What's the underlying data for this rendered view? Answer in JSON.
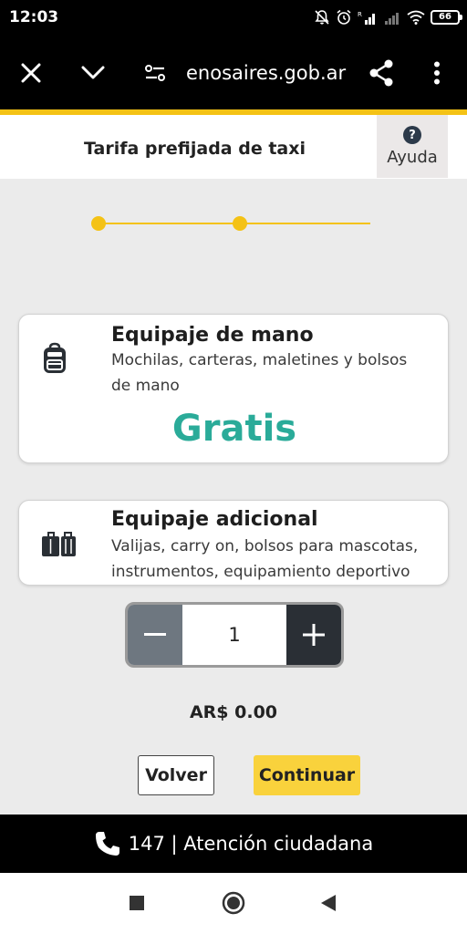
{
  "status_bar": {
    "time": "12:03",
    "battery": "66"
  },
  "browser": {
    "url": "enosaires.gob.ar"
  },
  "header": {
    "title": "Tarifa prefijada de taxi",
    "help_label": "Ayuda",
    "help_symbol": "?"
  },
  "progress": {
    "steps_total": 3,
    "current_step": 2
  },
  "cards": [
    {
      "title": "Equipaje de mano",
      "description": "Mochilas, carteras, maletines y bolsos de mano",
      "price": "Gratis",
      "icon": "backpack-icon"
    },
    {
      "title": "Equipaje adicional",
      "description": "Valijas, carry on, bolsos para mascotas, instrumentos, equipamiento deportivo",
      "icon": "luggage-icon"
    }
  ],
  "quantity": {
    "value": "1"
  },
  "total": "AR$ 0.00",
  "buttons": {
    "back": "Volver",
    "next": "Continuar"
  },
  "footer": {
    "text": "147 | Atención ciudadana",
    "icon": "phone-icon"
  },
  "colors": {
    "accent_yellow": "#f4c215",
    "price_teal": "#2aab99",
    "button_yellow": "#f9d23c"
  }
}
